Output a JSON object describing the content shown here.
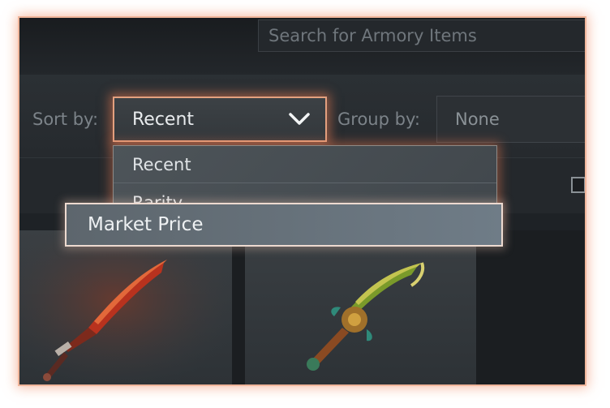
{
  "search": {
    "placeholder": "Search for Armory Items"
  },
  "sort": {
    "label": "Sort by:",
    "selected": "Recent",
    "options": [
      "Recent",
      "Rarity",
      "Market Price"
    ],
    "highlighted": "Market Price"
  },
  "group": {
    "label": "Group by:",
    "selected": "None"
  },
  "colors": {
    "accent_glow": "#e3a07f",
    "background": "#1e2226"
  },
  "icons": {
    "dropdown": "chevron-down-icon",
    "item1": "red-sword-icon",
    "item2": "green-sword-icon"
  }
}
